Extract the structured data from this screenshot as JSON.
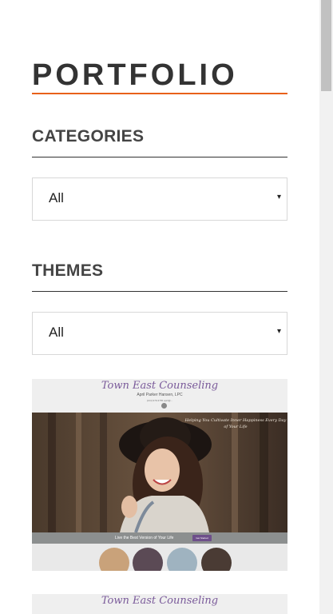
{
  "page": {
    "title": "PORTFOLIO",
    "accent_color": "#e8611a"
  },
  "categories": {
    "heading": "CATEGORIES",
    "selected": "All",
    "arrow": "▾"
  },
  "themes": {
    "heading": "THEMES",
    "selected": "All",
    "arrow": "▾"
  },
  "portfolio_items": [
    {
      "logo": "Town East Counseling",
      "subtitle": "April Parker Hansen, LPC",
      "contact": "(214) 979-3765  april@...",
      "tagline": "Helping You Cultivate Inner Happiness Every Day of Your Life",
      "band_text": "Live the Best Version of Your Life",
      "band_button": "Get Started"
    },
    {
      "logo": "Town East Counseling"
    }
  ]
}
